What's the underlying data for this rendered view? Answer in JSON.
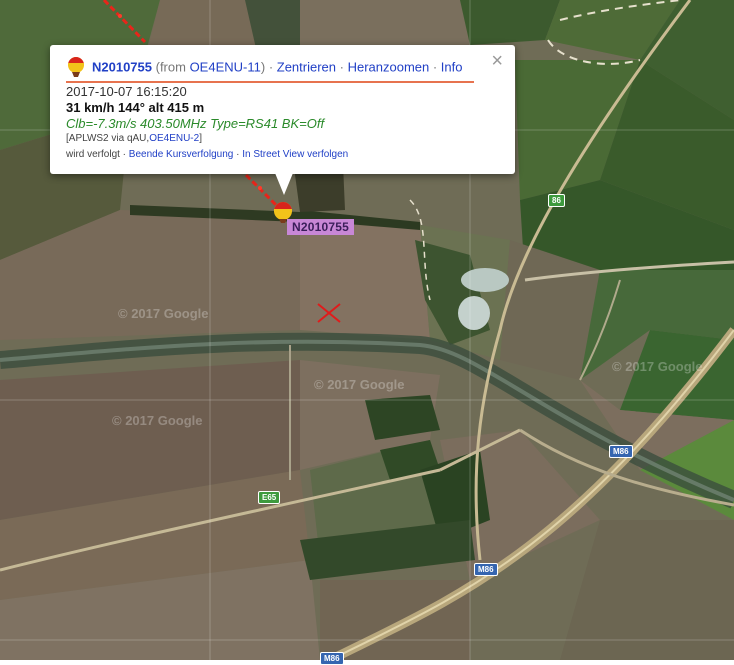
{
  "popup": {
    "callsign": "N2010755",
    "from_prefix": " (from ",
    "from_station": "OE4ENU-11",
    "from_suffix": ")",
    "sep": " · ",
    "actions": [
      "Zentrieren",
      "Heranzoomen",
      "Info"
    ],
    "close_symbol": "×",
    "timestamp": "2017-10-07 16:15:20",
    "speed_course_alt": "31 km/h 144° alt 415 m",
    "comment": "Clb=-7.3m/s 403.50MHz Type=RS41 BK=Off",
    "path_prefix": "[APLWS2 via qAU,",
    "path_station": "OE4ENU-2",
    "path_suffix": "]",
    "track_prefix": "wird verfolgt · ",
    "track_stop": "Beende Kursverfolgung",
    "track_sep": " · ",
    "track_streetview": "In Street View verfolgen"
  },
  "map": {
    "marker_label": "N2010755",
    "watermark": "© 2017 Google",
    "shields": {
      "r86": "86",
      "m86_a": "M86",
      "m86_b": "M86",
      "m86_c": "M86",
      "e65": "E65"
    },
    "colors": {
      "track": "#e8251a",
      "landing_mark": "#e01b1b",
      "label_bg": "#c887d6",
      "accent_link": "#2140c6",
      "divider": "#e7734f"
    }
  }
}
